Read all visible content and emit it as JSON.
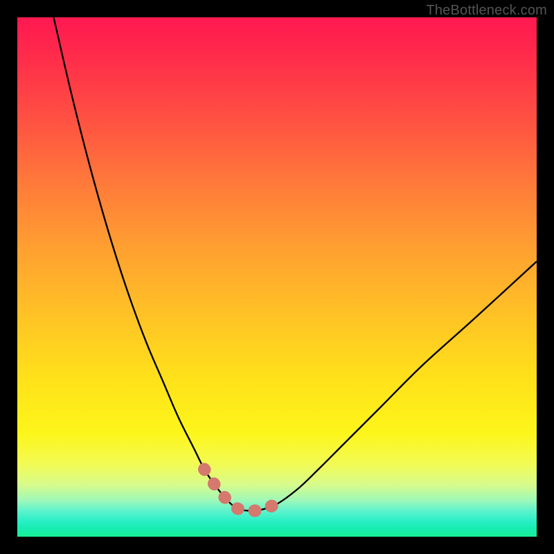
{
  "watermark": "TheBottleneck.com",
  "chart_data": {
    "type": "line",
    "title": "",
    "xlabel": "",
    "ylabel": "",
    "xlim": [
      0,
      100
    ],
    "ylim": [
      0,
      100
    ],
    "grid": false,
    "series": [
      {
        "name": "bottleneck-curve",
        "x": [
          7,
          10,
          13,
          16,
          19,
          22,
          25,
          28,
          31,
          34,
          36,
          38,
          40,
          41.5,
          43,
          45,
          47,
          50,
          54,
          58,
          63,
          70,
          78,
          88,
          100
        ],
        "values": [
          100,
          87,
          75,
          64,
          54,
          45,
          37,
          30,
          23,
          17,
          13,
          10,
          7.5,
          6,
          5.2,
          5,
          5.2,
          6.3,
          9.2,
          13,
          18,
          25,
          33,
          42,
          53
        ]
      },
      {
        "name": "highlight-segment",
        "x": [
          36,
          38,
          40,
          41.5,
          43,
          45,
          47,
          50
        ],
        "values": [
          13,
          10,
          7.5,
          6,
          5.2,
          5,
          5.2,
          6.3
        ]
      }
    ],
    "colors": {
      "curve": "#000000",
      "highlight": "#d5786e"
    }
  }
}
